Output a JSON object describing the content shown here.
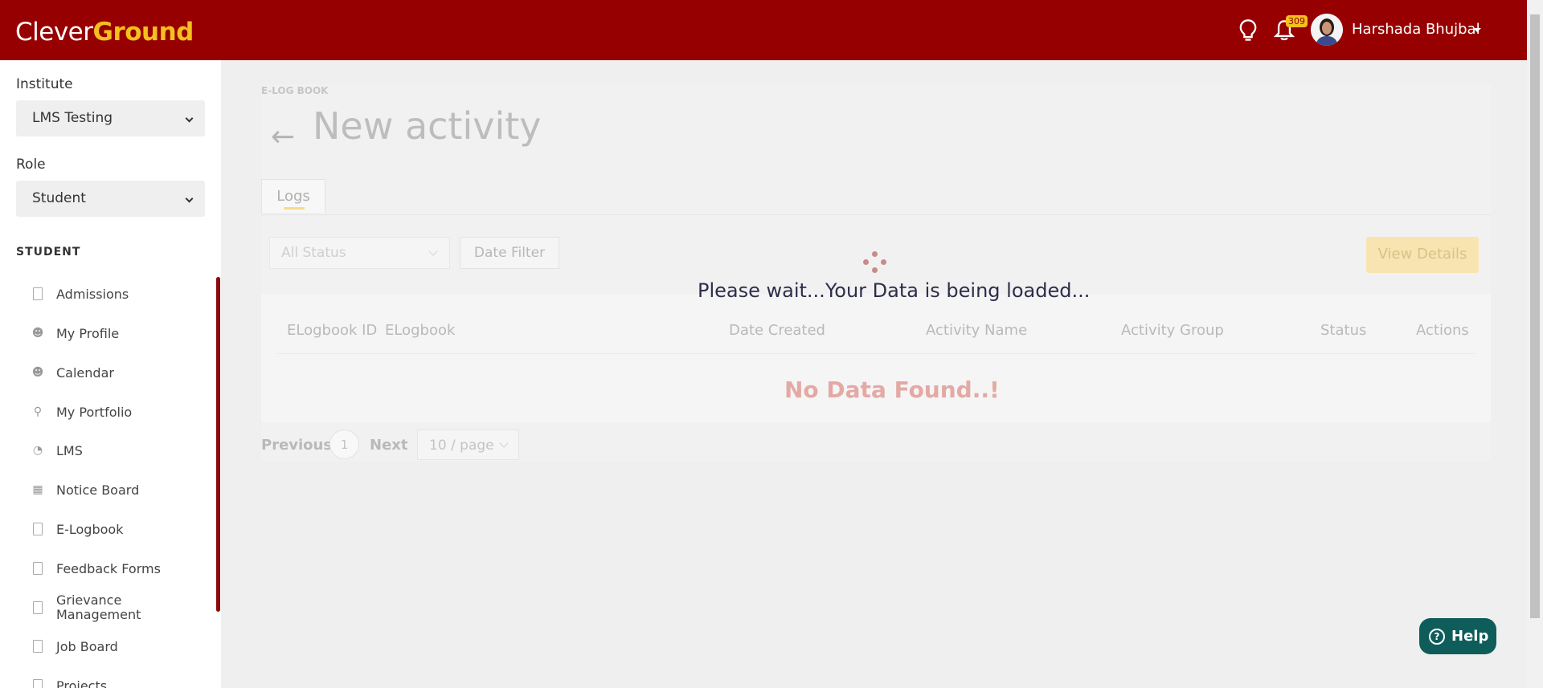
{
  "header": {
    "logo_part1": "Clever",
    "logo_part2": "Ground",
    "notification_count": "309",
    "user_name": "Harshada Bhujbal"
  },
  "sidebar": {
    "institute_label": "Institute",
    "institute_value": "LMS Testing",
    "role_label": "Role",
    "role_value": "Student",
    "section_title": "STUDENT",
    "items": [
      {
        "label": "Admissions",
        "icon": "document-icon"
      },
      {
        "label": "My Profile",
        "icon": "user-icon"
      },
      {
        "label": "Calendar",
        "icon": "user-icon"
      },
      {
        "label": "My Portfolio",
        "icon": "trophy-icon"
      },
      {
        "label": "LMS",
        "icon": "gauge-icon"
      },
      {
        "label": "Notice Board",
        "icon": "calendar-icon"
      },
      {
        "label": "E-Logbook",
        "icon": "document-icon"
      },
      {
        "label": "Feedback Forms",
        "icon": "document-icon"
      },
      {
        "label": "Grievance Management",
        "icon": "document-icon"
      },
      {
        "label": "Job Board",
        "icon": "document-icon"
      },
      {
        "label": "Projects",
        "icon": "document-icon"
      }
    ]
  },
  "main": {
    "breadcrumb": "E-LOG BOOK",
    "title": "New activity",
    "tab": "Logs",
    "status_placeholder": "All Status",
    "date_filter": "Date Filter",
    "view_details": "View Details",
    "columns": [
      "ELogbook ID",
      "ELogbook",
      "Date Created",
      "Activity Name",
      "Activity Group",
      "Status",
      "Actions"
    ],
    "empty_message": "No Data Found..!",
    "pagination": {
      "previous": "Previous",
      "page": "1",
      "next": "Next",
      "page_size": "10 / page"
    }
  },
  "loader": {
    "message": "Please wait...Your Data is being loaded..."
  },
  "help": {
    "label": "Help"
  },
  "colors": {
    "brand": "#970000",
    "accent": "#f3c020",
    "help": "#0e5d5a"
  }
}
